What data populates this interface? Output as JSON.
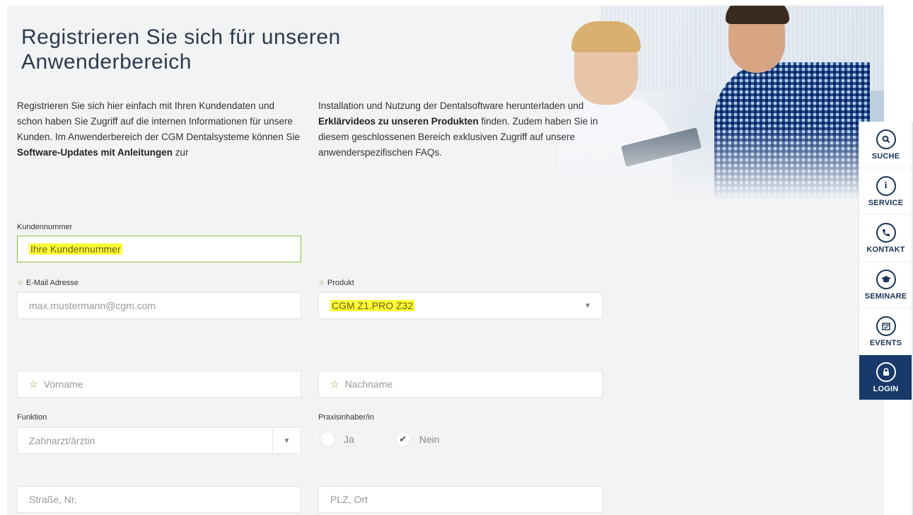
{
  "heading": "Registrieren Sie sich für unseren Anwenderbereich",
  "intro": {
    "col1_a": "Registrieren Sie sich hier einfach mit Ihren Kundendaten und schon haben Sie Zugriff auf die internen Informationen für unsere Kunden. Im Anwenderbereich der CGM Dentalsysteme können Sie ",
    "col1_bold": "Software-Updates mit Anleitungen",
    "col1_b": " zur",
    "col2_a": "Installation und Nutzung der Dentalsoftware herunterladen und ",
    "col2_bold": "Erklärvideos zu unseren Produkten",
    "col2_b": " finden. Zudem haben Sie in diesem geschlossenen Bereich exklusiven Zugriff auf unsere anwenderspezifischen FAQs."
  },
  "form": {
    "kundennummer_label": "Kundennummer",
    "kundennummer_placeholder": "Ihre Kundennummer",
    "email_label": "E-Mail Adresse",
    "email_placeholder": "max.mustermann@cgm.com",
    "produkt_label": "Produkt",
    "produkt_value": "CGM Z1.PRO Z32",
    "vorname_placeholder": "Vorname",
    "nachname_placeholder": "Nachname",
    "funktion_label": "Funktion",
    "funktion_value": "Zahnarzt/ärztin",
    "praxisinhaber_label": "Praxisinhaber/in",
    "radio_ja": "Ja",
    "radio_nein": "Nein",
    "radio_selected": "Nein",
    "strasse_placeholder": "Straße, Nr.",
    "plz_placeholder": "PLZ, Ort"
  },
  "sidebar": {
    "items": [
      {
        "label": "SUCHE",
        "icon": "search-icon"
      },
      {
        "label": "SERVICE",
        "icon": "info-icon"
      },
      {
        "label": "KONTAKT",
        "icon": "phone-icon"
      },
      {
        "label": "SEMINARE",
        "icon": "graduation-cap-icon"
      },
      {
        "label": "EVENTS",
        "icon": "calendar-check-icon"
      },
      {
        "label": "LOGIN",
        "icon": "lock-icon"
      }
    ]
  },
  "colors": {
    "accent_green": "#8aa33c",
    "highlight": "#ffff3a",
    "navy": "#173a6a"
  }
}
